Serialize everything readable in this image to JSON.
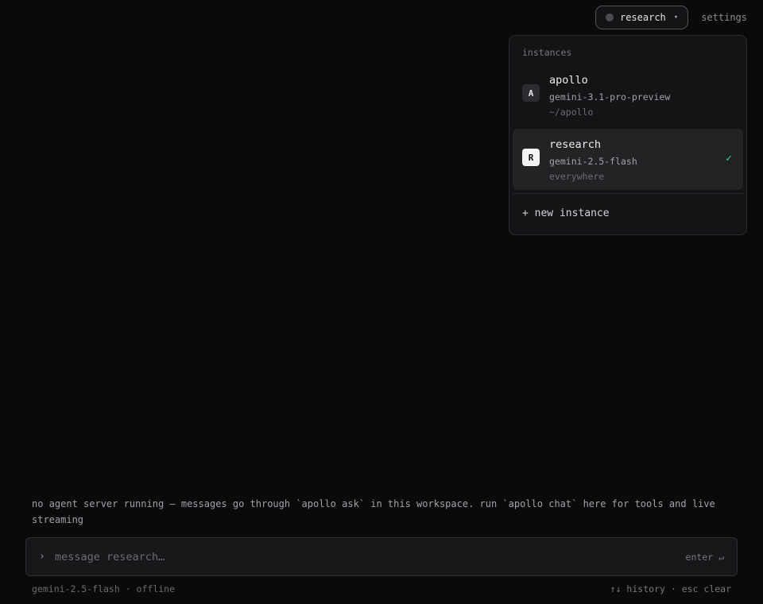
{
  "header": {
    "current_instance": "research",
    "dropdown_caret": "▾",
    "settings_label": "settings"
  },
  "dropdown": {
    "heading": "instances",
    "items": [
      {
        "letter": "A",
        "name": "apollo",
        "model": "gemini-3.1-pro-preview",
        "path": "~/apollo",
        "selected": false
      },
      {
        "letter": "R",
        "name": "research",
        "model": "gemini-2.5-flash",
        "path": "everywhere",
        "selected": true,
        "check": "✓"
      }
    ],
    "new_instance_label": "+ new instance"
  },
  "notice": "no agent server running — messages go through `apollo ask` in this workspace. run `apollo chat` here for tools and live streaming",
  "composer": {
    "prompt_glyph": "›",
    "placeholder": "message research…",
    "enter_hint": "enter ↵"
  },
  "footer": {
    "status": "gemini-2.5-flash · offline",
    "history_hint": "↑↓ history",
    "separator": " · ",
    "clear_hint": "esc clear"
  },
  "colors": {
    "background": "#0a0a0b",
    "panel": "#141416",
    "selected_row": "#232326",
    "check_green": "#34d399"
  }
}
